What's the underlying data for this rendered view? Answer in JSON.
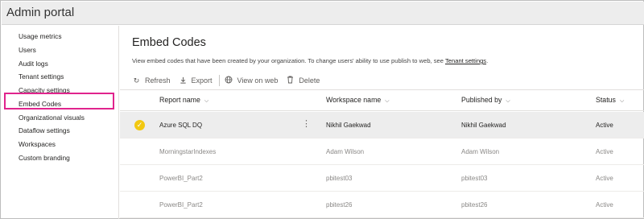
{
  "app": {
    "title": "Admin portal"
  },
  "sidebar": {
    "items": [
      {
        "label": "Usage metrics"
      },
      {
        "label": "Users"
      },
      {
        "label": "Audit logs"
      },
      {
        "label": "Tenant settings"
      },
      {
        "label": "Capacity settings"
      },
      {
        "label": "Embed Codes"
      },
      {
        "label": "Organizational visuals"
      },
      {
        "label": "Dataflow settings"
      },
      {
        "label": "Workspaces"
      },
      {
        "label": "Custom branding"
      }
    ],
    "active": "Embed Codes",
    "highlight_color": "#e0248d"
  },
  "main": {
    "title": "Embed Codes",
    "description": "View embed codes that have been created by your organization. To change users' ability to use publish to web, see ",
    "description_link": "Tenant settings",
    "description_end": "."
  },
  "toolbar": {
    "refresh": "Refresh",
    "export": "Export",
    "view_on_web": "View on web",
    "delete": "Delete"
  },
  "table": {
    "columns": [
      "Report name",
      "Workspace name",
      "Published by",
      "Status"
    ],
    "rows": [
      {
        "report": "Azure SQL DQ",
        "workspace": "Nikhil Gaekwad",
        "published_by": "Nikhil Gaekwad",
        "status": "Active",
        "selected": true
      },
      {
        "report": "MorningstarIndexes",
        "workspace": "Adam Wilson",
        "published_by": "Adam Wilson",
        "status": "Active",
        "selected": false
      },
      {
        "report": "PowerBI_Part2",
        "workspace": "pbitest03",
        "published_by": "pbitest03",
        "status": "Active",
        "selected": false
      },
      {
        "report": "PowerBI_Part2",
        "workspace": "pbitest26",
        "published_by": "pbitest26",
        "status": "Active",
        "selected": false
      }
    ]
  },
  "icons": {
    "refresh": "refresh-icon",
    "export": "download-icon",
    "view_on_web": "globe-icon",
    "delete": "trash-icon",
    "selected": "checkmark-circle-icon",
    "more": "more-vertical-icon",
    "sort": "chevron-down-icon"
  },
  "colors": {
    "selected_check": "#f2c811",
    "selected_row": "#ededed"
  }
}
